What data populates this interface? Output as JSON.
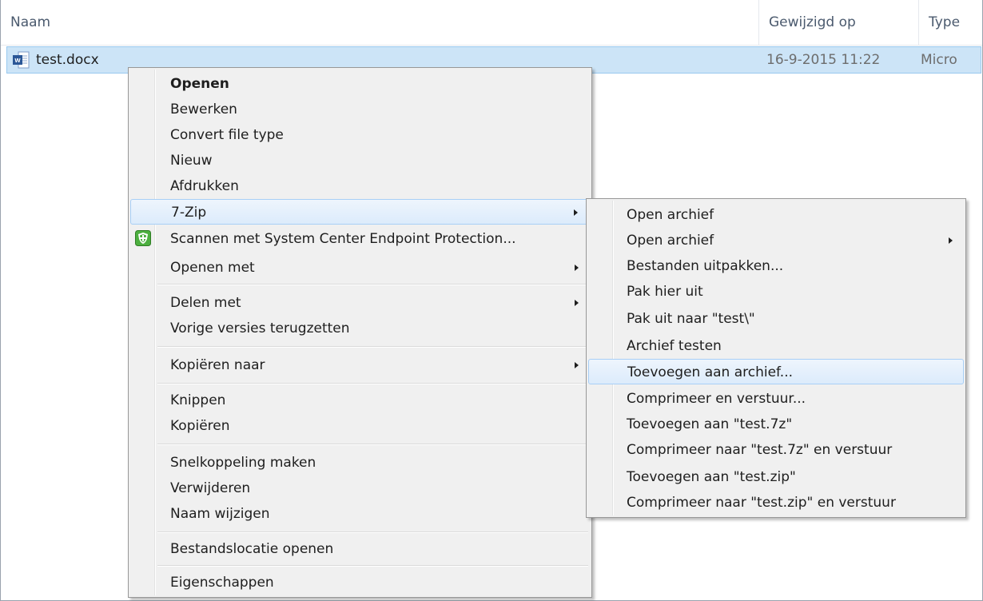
{
  "columns": {
    "name": "Naam",
    "modified": "Gewijzigd op",
    "type": "Type"
  },
  "file": {
    "name": "test.docx",
    "modified": "16-9-2015 11:22",
    "type": "Micro"
  },
  "context_menu": {
    "items": [
      {
        "label": "Openen"
      },
      {
        "label": "Bewerken"
      },
      {
        "label": "Convert file type"
      },
      {
        "label": "Nieuw"
      },
      {
        "label": "Afdrukken"
      },
      {
        "label": "7-Zip"
      },
      {
        "label": "Scannen met System Center Endpoint Protection..."
      },
      {
        "label": "Openen met"
      },
      {
        "label": "Delen met"
      },
      {
        "label": "Vorige versies terugzetten"
      },
      {
        "label": "Kopiëren naar"
      },
      {
        "label": "Knippen"
      },
      {
        "label": "Kopiëren"
      },
      {
        "label": "Snelkoppeling maken"
      },
      {
        "label": "Verwijderen"
      },
      {
        "label": "Naam wijzigen"
      },
      {
        "label": "Bestandslocatie openen"
      },
      {
        "label": "Eigenschappen"
      }
    ]
  },
  "zip_submenu": {
    "items": [
      {
        "label": "Open archief"
      },
      {
        "label": "Open archief"
      },
      {
        "label": "Bestanden uitpakken..."
      },
      {
        "label": "Pak hier uit"
      },
      {
        "label": "Pak uit naar \"test\\\""
      },
      {
        "label": "Archief testen"
      },
      {
        "label": "Toevoegen aan archief..."
      },
      {
        "label": "Comprimeer en verstuur..."
      },
      {
        "label": "Toevoegen aan \"test.7z\""
      },
      {
        "label": "Comprimeer naar \"test.7z\" en verstuur"
      },
      {
        "label": "Toevoegen aan \"test.zip\""
      },
      {
        "label": "Comprimeer naar \"test.zip\" en verstuur"
      }
    ]
  },
  "colors": {
    "selection": "#cce4f7",
    "highlight_border": "#a8cff6",
    "menu_bg": "#f0f0f0"
  }
}
